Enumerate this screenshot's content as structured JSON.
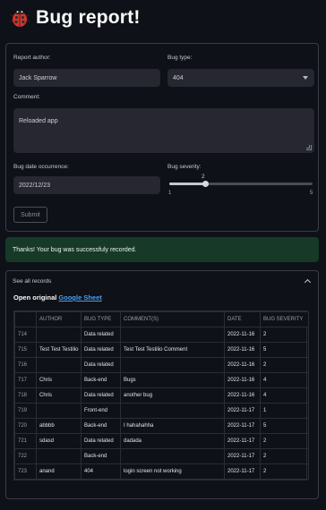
{
  "page": {
    "title": "Bug report!",
    "icon": "ladybug-icon"
  },
  "form": {
    "author": {
      "label": "Report author:",
      "value": "Jack Sparrow"
    },
    "bug_type": {
      "label": "Bug type:",
      "value": "404"
    },
    "comment": {
      "label": "Comment:",
      "value": "Reloaded app"
    },
    "date": {
      "label": "Bug date occurrence:",
      "value": "2022/12/23"
    },
    "severity": {
      "label": "Bug severity:",
      "value": "2",
      "min": "1",
      "max": "5",
      "level_fraction": 0.25
    },
    "submit_label": "Submit"
  },
  "success_message": "Thanks! Your bug was successfuly recorded.",
  "records": {
    "expander_label": "See all records",
    "open_prefix": "Open original ",
    "link_text": "Google Sheet",
    "columns": [
      "",
      "AUTHOR",
      "BUG TYPE",
      "COMMENT(S)",
      "DATE",
      "BUG SEVERITY"
    ],
    "rows": [
      [
        "714",
        "",
        "Data related",
        "",
        "2022-11-16",
        "2"
      ],
      [
        "715",
        "Test Test Testilio",
        "Data related",
        "Test Test Testilio Comment",
        "2022-11-16",
        "5"
      ],
      [
        "716",
        "",
        "Data related",
        "",
        "2022-11-16",
        "2"
      ],
      [
        "717",
        "Chris",
        "Back-end",
        "Bugs",
        "2022-11-16",
        "4"
      ],
      [
        "718",
        "Chris",
        "Data related",
        "another bug",
        "2022-11-16",
        "4"
      ],
      [
        "719",
        "",
        "Front-end",
        "",
        "2022-11-17",
        "1"
      ],
      [
        "720",
        "abbbb",
        "Back-end",
        "I hahahahha",
        "2022-11-17",
        "5"
      ],
      [
        "721",
        "sdasd",
        "Data related",
        "dadada",
        "2022-11-17",
        "2"
      ],
      [
        "722",
        "",
        "Back-end",
        "",
        "2022-11-17",
        "2"
      ],
      [
        "723",
        "anand",
        "404",
        "login screen not working",
        "2022-11-17",
        "2"
      ]
    ]
  },
  "colors": {
    "background": "#0e1117",
    "panel": "#262730",
    "success_bg": "#173928",
    "link": "#4a9ef8"
  }
}
